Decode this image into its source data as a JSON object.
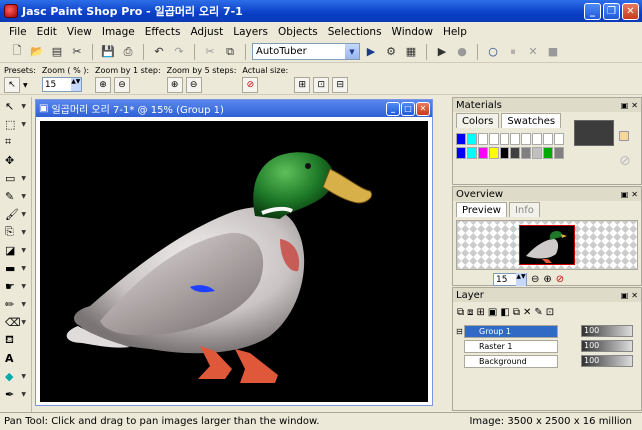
{
  "window": {
    "title": "Jasc Paint Shop Pro - 일곱머리 오리 7-1"
  },
  "menu": [
    "File",
    "Edit",
    "View",
    "Image",
    "Effects",
    "Adjust",
    "Layers",
    "Objects",
    "Selections",
    "Window",
    "Help"
  ],
  "toolbar": {
    "script_combo": "AutoTuber"
  },
  "tool_options": {
    "presets_label": "Presets:",
    "zoom_label": "Zoom ( % ):",
    "zoom_value": "15",
    "zoom_by1_label": "Zoom by 1 step:",
    "zoom_by5_label": "Zoom by 5 steps:",
    "actual_size_label": "Actual size:"
  },
  "document": {
    "title": "일곱머리 오리 7-1* @  15% (Group 1)"
  },
  "panels": {
    "materials": {
      "title": "Materials",
      "tab_colors": "Colors",
      "tab_swatches": "Swatches",
      "swatch_colors": [
        "#0000ff",
        "#00ffff",
        "#ffffff",
        "#ffffff",
        "#ffffff",
        "#ffffff",
        "#ffffff",
        "#ffffff",
        "#ffffff",
        "#ffffff",
        "#0000ff",
        "#00ffff",
        "#ff00ff",
        "#ffff00",
        "#000000",
        "#404040",
        "#808080",
        "#c0c0c0",
        "#00aa00",
        "#7f7f7f"
      ]
    },
    "overview": {
      "title": "Overview",
      "tab_preview": "Preview",
      "tab_info": "Info",
      "zoom_value": "15"
    },
    "layers": {
      "title": "Layer",
      "rows": [
        {
          "name": "Group 1",
          "opacity": "100"
        },
        {
          "name": "Raster 1",
          "opacity": "100"
        },
        {
          "name": "Background",
          "opacity": "100"
        }
      ]
    }
  },
  "status": {
    "message": "Pan Tool: Click and drag to pan images larger than the window.",
    "image_info": "Image:  3500 x 2500 x 16 million"
  }
}
